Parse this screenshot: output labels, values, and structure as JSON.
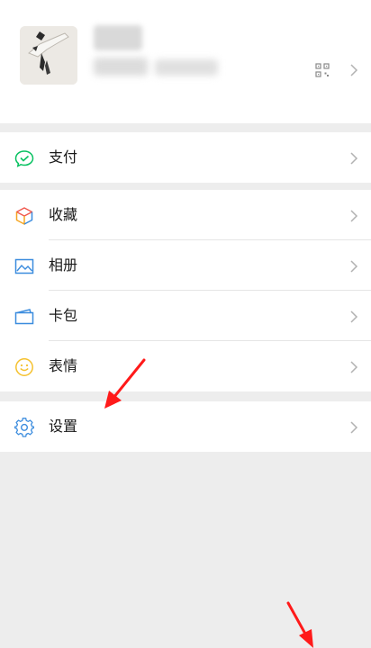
{
  "menu": {
    "pay": {
      "label": "支付",
      "icon": "wechat-pay-icon"
    },
    "favorites": {
      "label": "收藏",
      "icon": "cube-icon"
    },
    "album": {
      "label": "相册",
      "icon": "picture-icon"
    },
    "cards": {
      "label": "卡包",
      "icon": "wallet-card-icon"
    },
    "stickers": {
      "label": "表情",
      "icon": "smiley-icon"
    },
    "settings": {
      "label": "设置",
      "icon": "gear-icon"
    }
  },
  "colors": {
    "page_background": "#ededed",
    "pay_green": "#07c160",
    "favorites_orange": "#f6a623",
    "album_blue": "#3b8cde",
    "sticker_yellow": "#f5c12e",
    "annotation_red": "#ff1a1a"
  }
}
